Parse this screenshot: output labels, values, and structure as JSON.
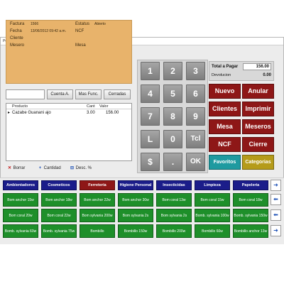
{
  "window": {
    "title": "Punto de Venta"
  },
  "info": {
    "factura_label": "Factura",
    "factura_value": "1566",
    "estatus_label": "Estatus",
    "estatus_value": "Abierto",
    "fecha_label": "Fecha",
    "fecha_value": "13/06/2012 09:42 a.m.",
    "ncf_label": "NCF",
    "cliente_label": "Cliente",
    "mesero_label": "Mesero",
    "mesa_label": "Mesa"
  },
  "commands": {
    "search_value": "",
    "cuenta": "Cuenta A.",
    "mas_func": "Mas Func.",
    "cerradas": "Cerradas"
  },
  "items": {
    "headers": {
      "producto": "Producto",
      "cant": "Cant",
      "valor": "Valor"
    },
    "rows": [
      {
        "marker": "▸",
        "producto": "Cazabe Guanani ajo",
        "cant": "3.00",
        "valor": "156.00"
      }
    ]
  },
  "actions": {
    "borrar": "Borrar",
    "cantidad": "Cantidad",
    "desc": "Desc. %"
  },
  "numpad": [
    "1",
    "2",
    "3",
    "4",
    "5",
    "6",
    "7",
    "8",
    "9",
    "L",
    "0",
    "Tcl",
    "$",
    ".",
    "OK"
  ],
  "totals": {
    "total_label": "Total a Pagar",
    "total_value": "156.00",
    "devolucion_label": "Devolucion",
    "devolucion_value": "0.00"
  },
  "functions": {
    "nuevo": "Nuevo",
    "anular": "Anular",
    "clientes": "Clientes",
    "imprimir": "Imprimir",
    "mesa": "Mesa",
    "meseros": "Meseros",
    "ncf": "NCF",
    "cierre": "Cierre",
    "favoritos": "Favoritos",
    "categorias": "Categorias"
  },
  "categories": [
    "Ambientadores",
    "Cosmeticos",
    "Ferreteria",
    "Higiene Personal",
    "Insecticidas",
    "Limpieza",
    "Papeleria"
  ],
  "products": [
    "Bom anchor 15w",
    "Bom anchor 18w",
    "Bom anchor 22w",
    "Bom anchor 30w",
    "Bom coral 13w",
    "Bom coral 15w",
    "Bom coral 18w",
    "Bom coral 20w",
    "Bom coral 22w",
    "Bom sylvania 200w",
    "Bom sylvania 2s",
    "Bom sylvania 2s",
    "Bomb. sylvania 100w",
    "Bomb. sylvania 150w",
    "Bomb. sylvania 60w",
    "Bomb. sylvania 75w",
    "Bombillo",
    "Bombillo 150w",
    "Bombillo 200w",
    "Bombillo 60w",
    "Bombillo anchor 13w"
  ],
  "colors": {
    "ferreteria": "#8e1717",
    "favoritos": "#1f9aa0",
    "categorias": "#b59b1a"
  }
}
